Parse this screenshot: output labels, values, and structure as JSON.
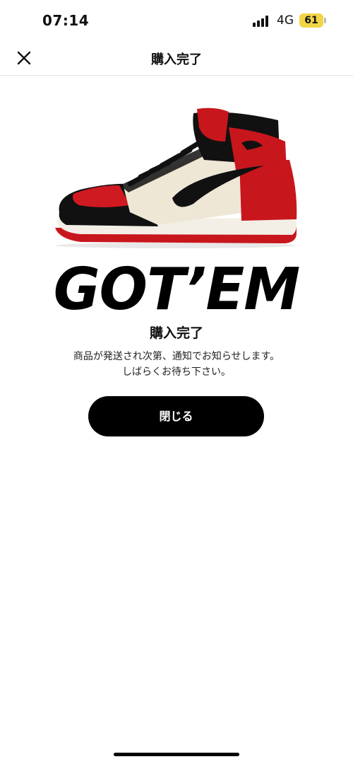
{
  "status_bar": {
    "time": "07:14",
    "network": "4G",
    "battery": "61",
    "battery_color": "#f1d547"
  },
  "nav": {
    "title": "購入完了",
    "close_icon": "close-icon"
  },
  "main": {
    "image": "sneaker-image",
    "headline": "GOT’EM",
    "heading": "購入完了",
    "message_line1": "商品が発送され次第、通知でお知らせします。",
    "message_line2": "しばらくお待ち下さい。",
    "close_button_label": "閉じる"
  },
  "colors": {
    "accent": "#000000",
    "shoe_red": "#c8161d"
  }
}
